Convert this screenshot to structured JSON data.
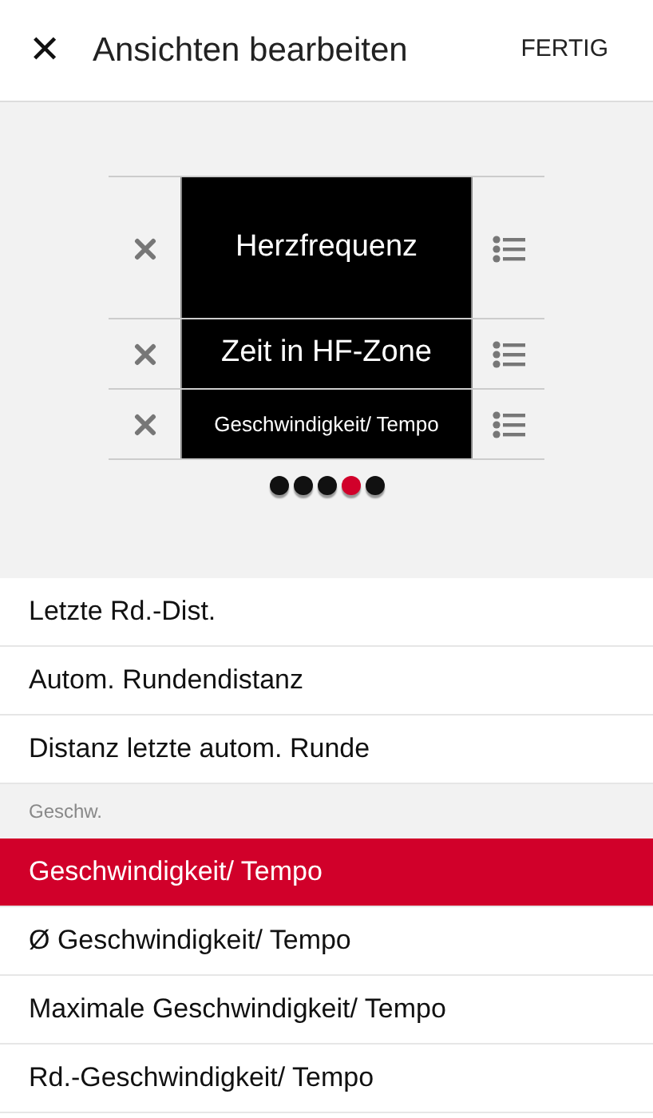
{
  "header": {
    "close": "✕",
    "title": "Ansichten bearbeiten",
    "done": "FERTIG"
  },
  "fields": [
    {
      "label": "Herzfrequenz",
      "kind": "large"
    },
    {
      "label": "Zeit in HF-Zone",
      "kind": "medium"
    },
    {
      "label": "Geschwindigkeit/ Tempo",
      "kind": "small"
    }
  ],
  "page_dots": [
    {
      "selected": false
    },
    {
      "selected": false
    },
    {
      "selected": false
    },
    {
      "selected": true
    },
    {
      "selected": false
    }
  ],
  "list": [
    {
      "kind": "item",
      "label": "Letzte Rd.-Dist.",
      "selected": false
    },
    {
      "kind": "item",
      "label": "Autom. Rundendistanz",
      "selected": false
    },
    {
      "kind": "item",
      "label": "Distanz letzte autom. Runde",
      "selected": false
    },
    {
      "kind": "header",
      "label": "Geschw."
    },
    {
      "kind": "item",
      "label": "Geschwindigkeit/ Tempo",
      "selected": true
    },
    {
      "kind": "item",
      "label": "Ø Geschwindigkeit/ Tempo",
      "selected": false
    },
    {
      "kind": "item",
      "label": "Maximale Geschwindigkeit/ Tempo",
      "selected": false
    },
    {
      "kind": "item",
      "label": "Rd.-Geschwindigkeit/ Tempo",
      "selected": false
    }
  ]
}
